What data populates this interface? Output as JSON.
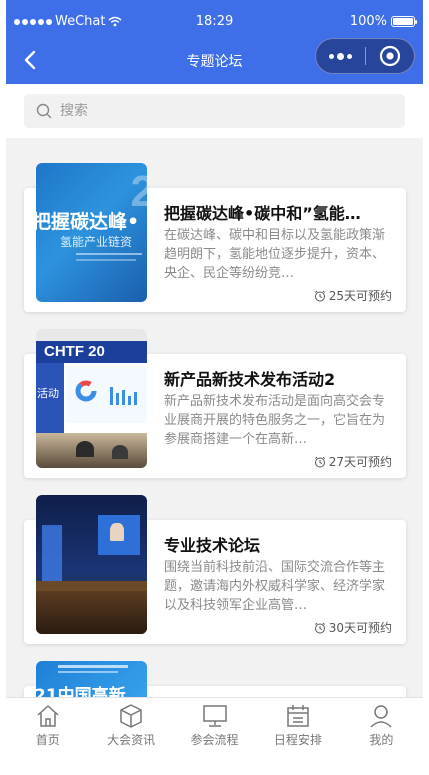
{
  "status_bar": {
    "carrier": "WeChat",
    "time": "18:29",
    "battery": "100%"
  },
  "nav": {
    "title": "专题论坛"
  },
  "search": {
    "placeholder": "搜索"
  },
  "cards": [
    {
      "title": "把握碳达峰•碳中和”氢能…",
      "desc": "在碳达峰、碳中和目标以及氢能政策渐趋明朗下，氢能地位逐步提升，资本、央企、民企等纷纷竞…",
      "days": "25天可预约",
      "thumb": {
        "line1": "把握碳达峰•",
        "line2": "氢能产业链资",
        "corner": "2"
      }
    },
    {
      "title": "新产品新技术发布活动2",
      "desc": "新产品新技术发布活动是面向高交会专业展商开展的特色服务之一，它旨在为参展商搭建一个在高新…",
      "days": "27天可预约",
      "thumb": {
        "banner": "CHTF 20",
        "side": "活动"
      }
    },
    {
      "title": "专业技术论坛",
      "desc": "围绕当前科技前沿、国际交流合作等主题，邀请海内外权威科学家、经济学家以及科技领军企业高管…",
      "days": "30天可预约",
      "thumb": {}
    },
    {
      "title": "",
      "desc": "",
      "days": "",
      "thumb": {
        "line1": "21中国高新"
      }
    }
  ],
  "tabs": [
    {
      "label": "首页",
      "icon": "home-icon"
    },
    {
      "label": "大会资讯",
      "icon": "cube-icon"
    },
    {
      "label": "参会流程",
      "icon": "monitor-icon"
    },
    {
      "label": "日程安排",
      "icon": "calendar-icon"
    },
    {
      "label": "我的",
      "icon": "user-icon"
    }
  ],
  "colors": {
    "header": "#3f6fe8",
    "tab_inactive": "#777777"
  }
}
